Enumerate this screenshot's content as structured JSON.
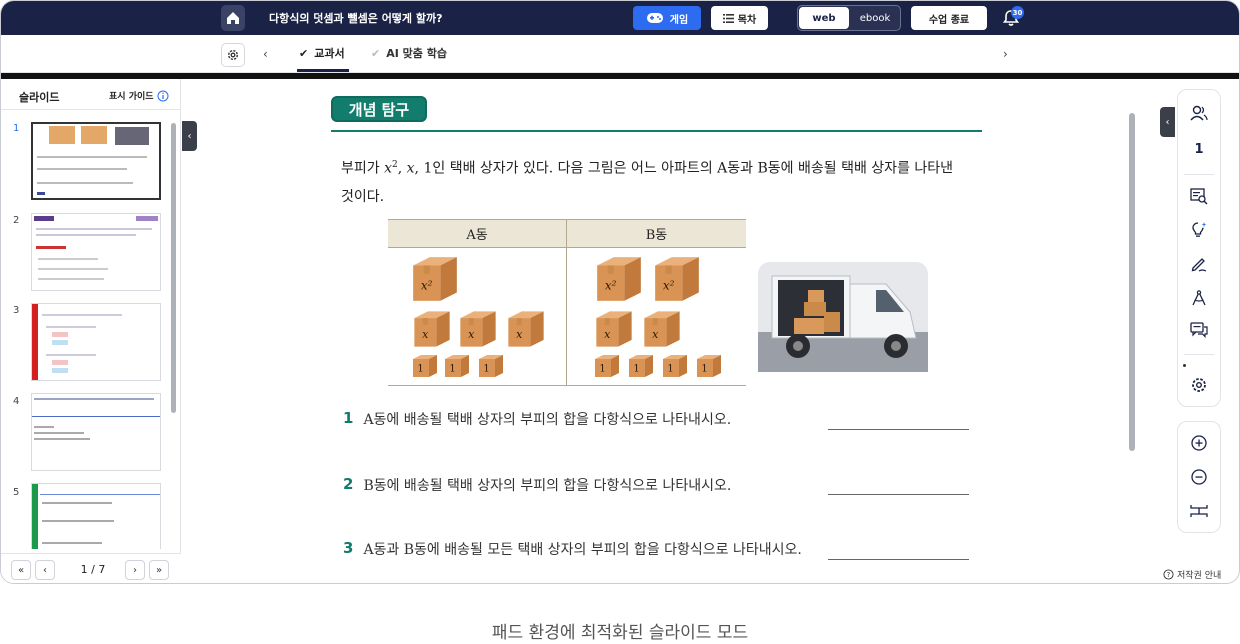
{
  "header": {
    "title": "다항식의 덧셈과 뺄셈은 어떻게 할까?",
    "game_label": "게임",
    "toc_label": "목차",
    "mode_web": "web",
    "mode_ebook": "ebook",
    "end_class_label": "수업 종료",
    "notification_count": "30"
  },
  "tabs": [
    {
      "label": "교과서",
      "active": true
    },
    {
      "label": "AI 맞춤 학습",
      "active": false
    }
  ],
  "sidebar": {
    "title": "슬라이드",
    "guide_label": "표시 가이드",
    "slides": [
      "1",
      "2",
      "3",
      "4",
      "5"
    ],
    "current_page": "1",
    "total_pages": "7",
    "page_text": "1 / 7"
  },
  "content": {
    "section_title": "개념 탐구",
    "intro_line1_a": "부피가 ",
    "intro_x2": "x",
    "intro_sup": "2",
    "intro_line1_b": ", ",
    "intro_x": "x",
    "intro_line1_c": ", ",
    "intro_one": "1",
    "intro_line1_d": "인 택배 상자가 있다. 다음 그림은 어느 아파트의 ",
    "intro_A": "A",
    "intro_line1_e": "동과 ",
    "intro_B": "B",
    "intro_line1_f": "동에 배송될 택배 상자를 나타낸",
    "intro_line2": "것이다.",
    "table_head_a": "A동",
    "table_head_b": "B동",
    "box_x2": "x²",
    "box_x": "x",
    "box_1": "1",
    "questions": [
      {
        "num": "1",
        "text": "A동에 배송될 택배 상자의 부피의 합을 다항식으로 나타내시오."
      },
      {
        "num": "2",
        "text": "B동에 배송될 택배 상자의 부피의 합을 다항식으로 나타내시오."
      },
      {
        "num": "3",
        "text": "A동과 B동에 배송될 모든 택배 상자의 부피의 합을 다항식으로 나타내시오."
      }
    ]
  },
  "rail": {
    "page_number": "1",
    "copyright_label": "저작권 안내"
  },
  "caption": "패드 환경에 최적화된 슬라이드 모드",
  "colors": {
    "navy": "#1a2245",
    "accent_blue": "#2d6bf1",
    "teal": "#127d6c",
    "box_brown": "#d89a5a"
  }
}
